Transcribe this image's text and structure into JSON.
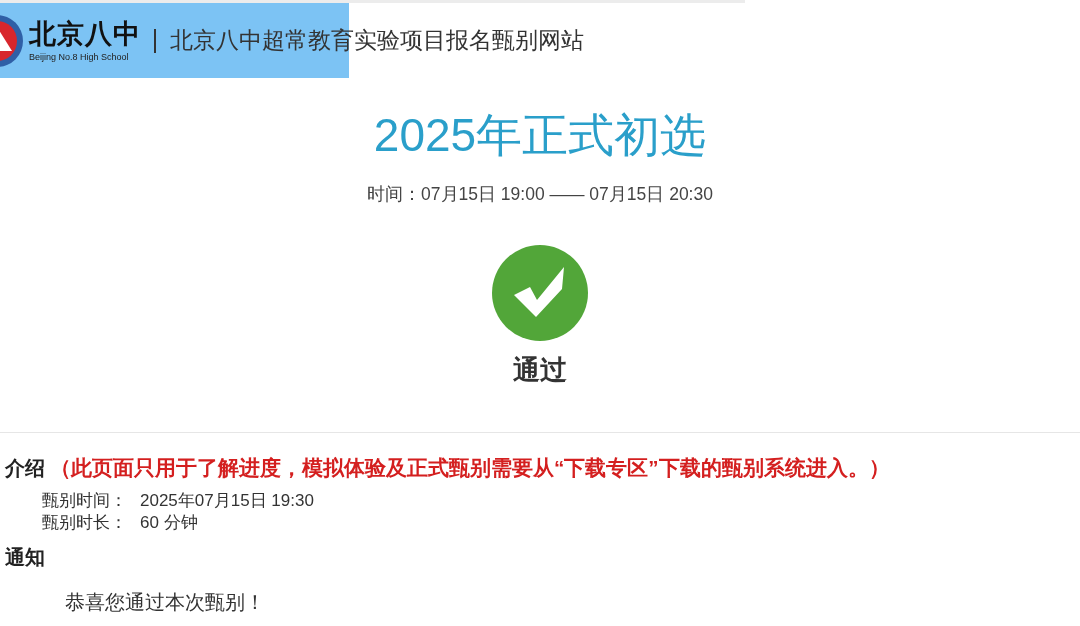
{
  "header": {
    "logo": {
      "name": "北京八中",
      "subtitle": "Beijing No.8 High School"
    },
    "site_title": "北京八中超常教育实验项目报名甄别网站"
  },
  "exam": {
    "title": "2025年正式初选",
    "time": "时间：07月15日 19:00 —— 07月15日 20:30",
    "result": {
      "kind": "passed",
      "label": "通过"
    }
  },
  "intro": {
    "heading": "介绍",
    "note": "（此页面只用于了解进度，模拟体验及正式甄别需要从“下载专区”下载的甄别系统进入。）",
    "details": [
      {
        "label": "甄别时间：",
        "value": "2025年07月15日 19:30"
      },
      {
        "label": "甄别时长：",
        "value": "60 分钟"
      }
    ]
  },
  "notice": {
    "heading": "通知",
    "message": "恭喜您通过本次甄别！"
  }
}
